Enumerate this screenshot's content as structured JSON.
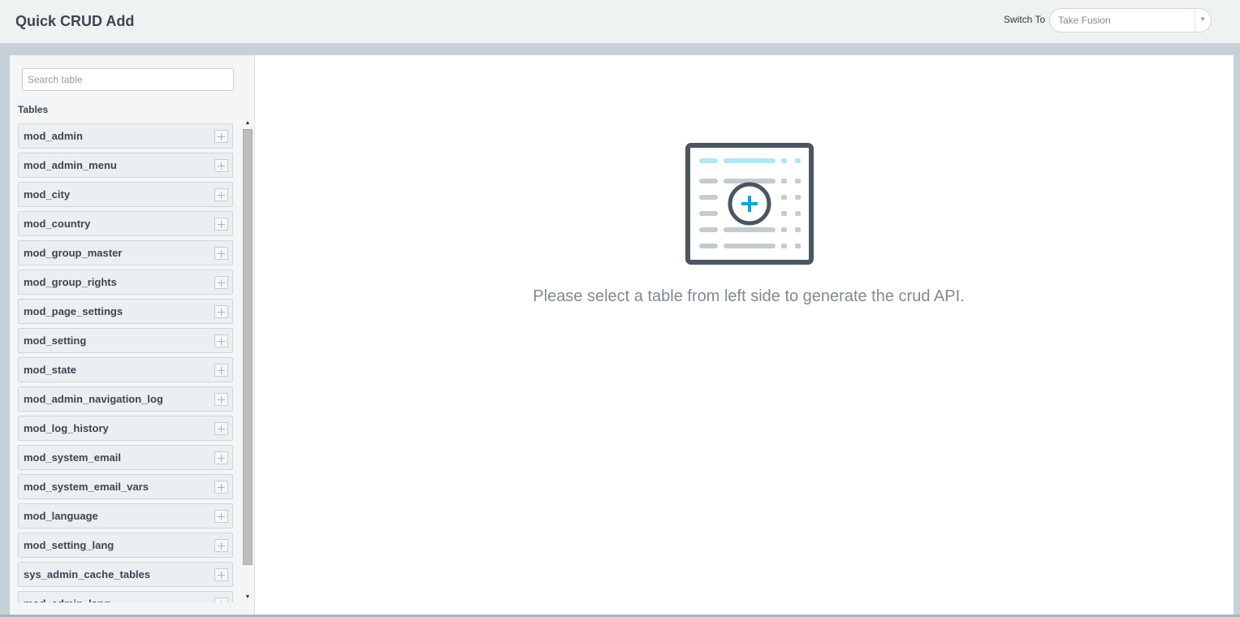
{
  "header": {
    "title": "Quick CRUD Add",
    "switch_label": "Switch To",
    "switch_value": "Take Fusion"
  },
  "sidebar": {
    "search_placeholder": "Search table",
    "tables_heading": "Tables",
    "tables": [
      "mod_admin",
      "mod_admin_menu",
      "mod_city",
      "mod_country",
      "mod_group_master",
      "mod_group_rights",
      "mod_page_settings",
      "mod_setting",
      "mod_state",
      "mod_admin_navigation_log",
      "mod_log_history",
      "mod_system_email",
      "mod_system_email_vars",
      "mod_language",
      "mod_setting_lang",
      "sys_admin_cache_tables",
      "mod_admin_lang"
    ]
  },
  "main": {
    "empty_message": "Please select a table from left side to generate the crud API."
  },
  "colors": {
    "accent": "#00a9d6",
    "header_bg": "#eff2f3",
    "frame_bg": "#c5d0d8",
    "icon_dark": "#4a5660"
  }
}
